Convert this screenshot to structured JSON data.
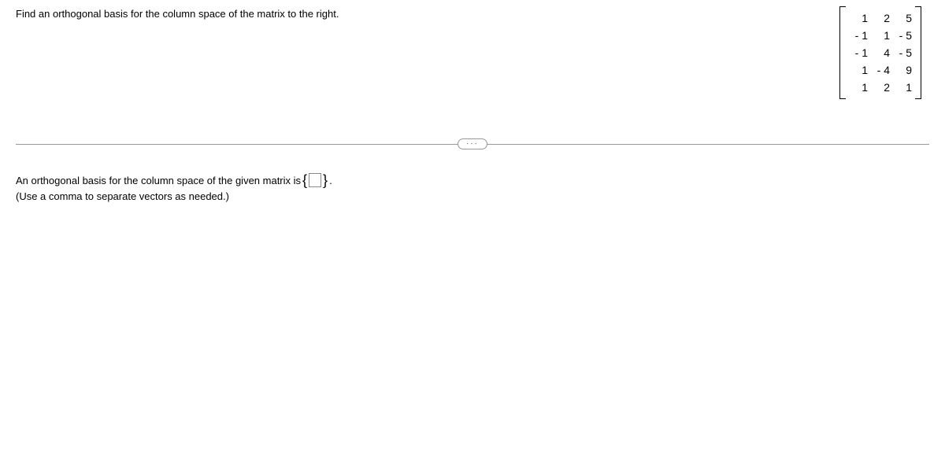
{
  "question": "Find an orthogonal basis for the column space of the matrix to the right.",
  "matrix": {
    "rows": [
      [
        "1",
        "2",
        "5"
      ],
      [
        "- 1",
        "1",
        "- 5"
      ],
      [
        "- 1",
        "4",
        "- 5"
      ],
      [
        "1",
        "- 4",
        "9"
      ],
      [
        "1",
        "2",
        "1"
      ]
    ]
  },
  "ellipsis": "···",
  "answer": {
    "prefix": "An orthogonal basis for the column space of the given matrix is ",
    "left_brace": "{",
    "right_brace": "}",
    "suffix": ".",
    "input_value": ""
  },
  "hint": "(Use a comma to separate vectors as needed.)"
}
